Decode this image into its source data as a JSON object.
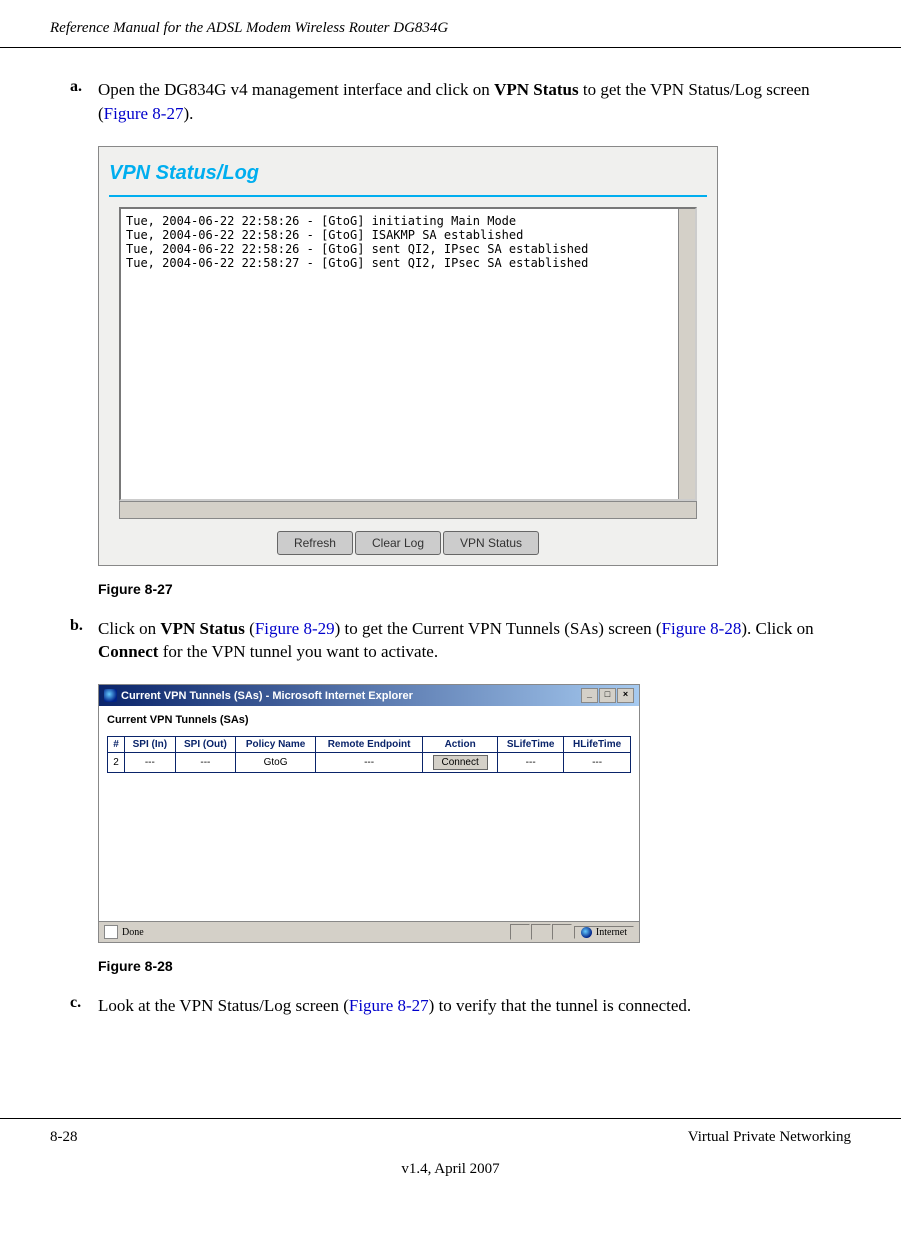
{
  "header": "Reference Manual for the ADSL Modem Wireless Router DG834G",
  "step_a": {
    "letter": "a.",
    "pre": "Open the DG834G v4 management interface and click on ",
    "bold": "VPN Status",
    "post": " to get the VPN Status/Log screen (",
    "link": "Figure 8-27",
    "end": ")."
  },
  "figure1": {
    "title": "VPN Status/Log",
    "log": [
      "Tue, 2004-06-22 22:58:26 - [GtoG] initiating Main Mode",
      "Tue, 2004-06-22 22:58:26 - [GtoG] ISAKMP SA established",
      "Tue, 2004-06-22 22:58:26 - [GtoG] sent QI2, IPsec SA established",
      "Tue, 2004-06-22 22:58:27 - [GtoG] sent QI2, IPsec SA established"
    ],
    "buttons": [
      "Refresh",
      "Clear Log",
      "VPN Status"
    ],
    "caption": "Figure 8-27"
  },
  "step_b": {
    "letter": "b.",
    "t1": "Click on ",
    "b1": "VPN Status",
    "t2": " (",
    "l1": "Figure 8-29",
    "t3": ") to get the Current VPN Tunnels (SAs) screen (",
    "l2": "Figure 8-28",
    "t4": "). Click on ",
    "b2": "Connect",
    "t5": " for the VPN tunnel you want to activate."
  },
  "figure2": {
    "ie_title": "Current VPN Tunnels (SAs) - Microsoft Internet Explorer",
    "heading": "Current VPN Tunnels (SAs)",
    "cols": [
      "#",
      "SPI (In)",
      "SPI (Out)",
      "Policy Name",
      "Remote Endpoint",
      "Action",
      "SLifeTime",
      "HLifeTime"
    ],
    "row": {
      "num": "2",
      "spi_in": "---",
      "spi_out": "---",
      "policy": "GtoG",
      "remote": "---",
      "action": "Connect",
      "sl": "---",
      "hl": "---"
    },
    "status_done": "Done",
    "status_net": "Internet",
    "caption": "Figure 8-28"
  },
  "step_c": {
    "letter": "c.",
    "t1": "Look at the VPN Status/Log screen (",
    "l1": "Figure 8-27",
    "t2": ") to verify that the tunnel is connected."
  },
  "footer": {
    "left": "8-28",
    "right": "Virtual Private Networking",
    "center": "v1.4, April 2007"
  }
}
